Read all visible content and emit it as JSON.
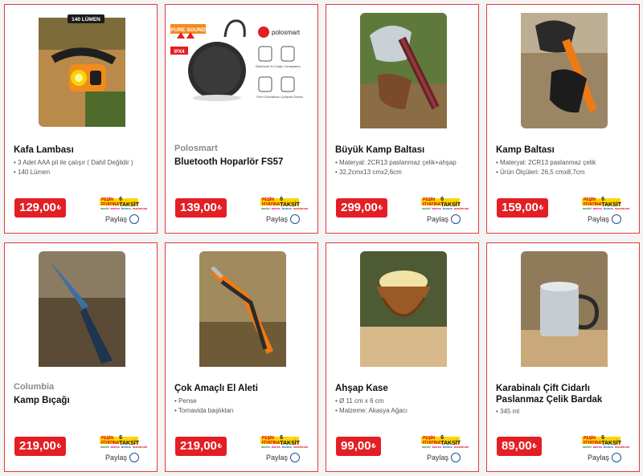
{
  "currency_symbol": "₺",
  "share_label": "Paylaş",
  "taksit_badge": {
    "top_left": "PEŞİN FİYATINA",
    "top_right": "6 TAKSİT",
    "cards": [
      "world",
      "axess",
      "bonus",
      "maximum"
    ]
  },
  "products": [
    {
      "brand": "",
      "title": "Kafa Lambası",
      "features": [
        "3 Adet AAA pil ile çalışır ( Dahil Değildir )",
        "140 Lümen"
      ],
      "price": "129,00",
      "image_badge": "140 LÜMEN",
      "image": "head-lamp-image"
    },
    {
      "brand": "Polosmart",
      "title": "Bluetooth Hoparlör FS57",
      "features": [],
      "price": "139,00",
      "image_badge_a": "PURE SOUND",
      "image_badge_b": "IPX4",
      "image_logo": "polosmart",
      "image_icon_labels": [
        "Bluetooth 5.0",
        "Çağrı Cevaplama",
        "Pure Sound",
        "Uzun Çalışma Süresi"
      ],
      "image": "bluetooth-speaker-image"
    },
    {
      "brand": "",
      "title": "Büyük Kamp Baltası",
      "features": [
        "Materyal: 2CR13 paslanmaz çelik+ahşap",
        "32,2cmx13 cmx2,6cm"
      ],
      "price": "299,00",
      "image": "camp-axe-large-image"
    },
    {
      "brand": "",
      "title": "Kamp Baltası",
      "features": [
        "Materyal: 2CR13 paslanmaz çelik",
        "Ürün Ölçüleri: 26,5 cmx8,7cm"
      ],
      "price": "159,00",
      "image": "camp-axe-image"
    },
    {
      "brand": "Columbia",
      "title": "Kamp Bıçağı",
      "features": [],
      "price": "219,00",
      "image": "camp-knife-image"
    },
    {
      "brand": "",
      "title": "Çok Amaçlı El Aleti",
      "features": [
        "Pense",
        "Tornavida başlıkları"
      ],
      "price": "219,00",
      "image": "multi-tool-image"
    },
    {
      "brand": "",
      "title": "Ahşap Kase",
      "features": [
        "Ø 11 cm x 6 cm",
        "Malzeme: Akasya Ağacı"
      ],
      "price": "99,00",
      "image": "wooden-bowl-image"
    },
    {
      "brand": "",
      "title": "Karabinalı Çift Cidarlı Paslanmaz Çelik Bardak",
      "features": [
        "345 ml"
      ],
      "price": "89,00",
      "image": "steel-mug-image"
    }
  ]
}
